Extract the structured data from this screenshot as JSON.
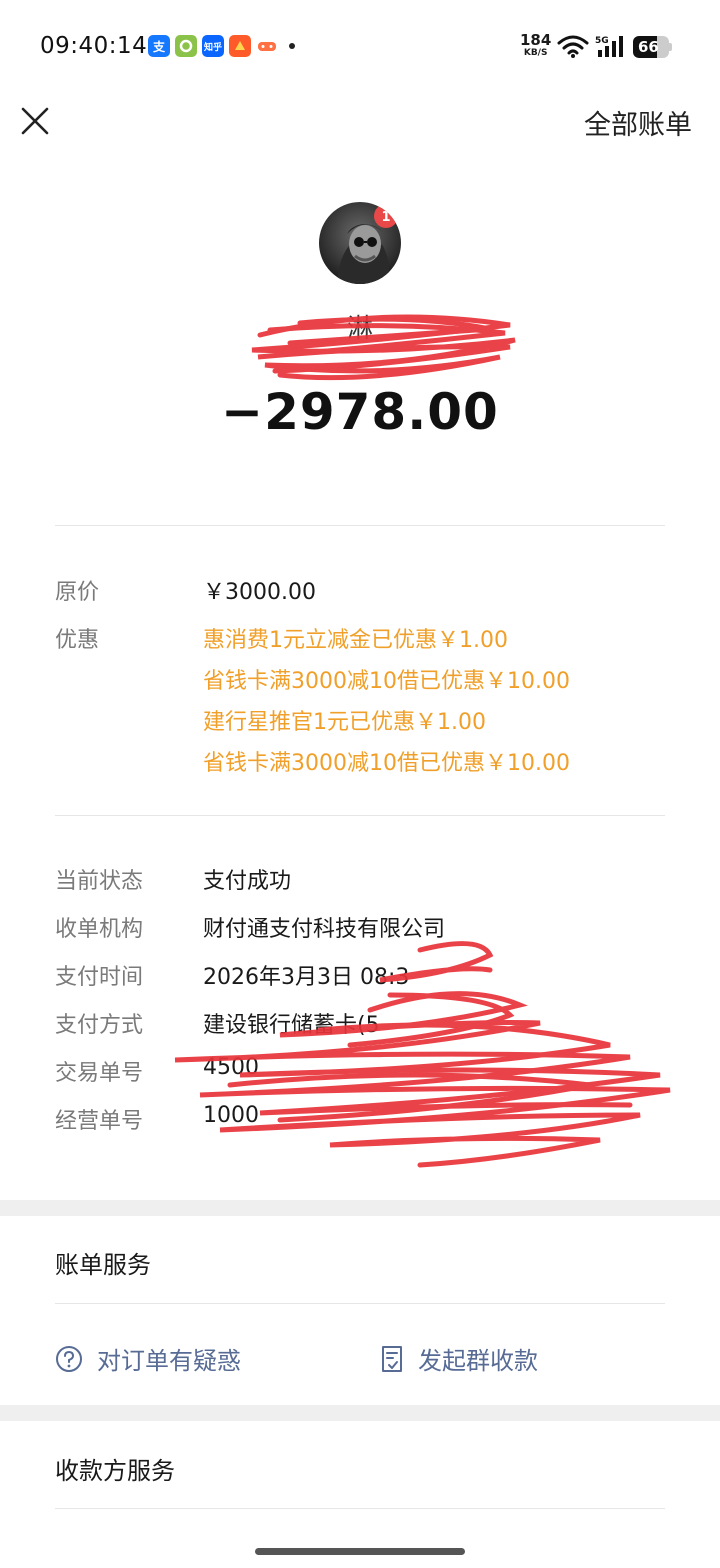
{
  "status_bar": {
    "time": "09:40:14",
    "net_speed_value": "184",
    "net_speed_unit": "KB/S",
    "network": "5G",
    "battery": "66",
    "battery_level": 0.66,
    "app_icons": [
      {
        "name": "alipay-icon",
        "glyph": "支",
        "color": "#1677ff"
      },
      {
        "name": "green-app-icon",
        "glyph": "",
        "color": "#8bc34a"
      },
      {
        "name": "zhihu-icon",
        "glyph": "知乎",
        "color": "#0a66ff"
      },
      {
        "name": "red-app-icon",
        "glyph": "",
        "color": "#ff5a2a"
      },
      {
        "name": "game-icon",
        "glyph": "",
        "color": "#ff7043"
      }
    ]
  },
  "nav": {
    "close_icon": "close-icon",
    "all_bills_label": "全部账单"
  },
  "header": {
    "merchant_name": "淋",
    "amount": "−2978.00",
    "avatar_badge": "1"
  },
  "price": {
    "original_label": "原价",
    "original_value": "￥3000.00",
    "discount_label": "优惠",
    "discounts": [
      "惠消费1元立减金已优惠￥1.00",
      "省钱卡满3000减10借已优惠￥10.00",
      "建行星推官1元已优惠￥1.00",
      "省钱卡满3000减10借已优惠￥10.00"
    ]
  },
  "details": [
    {
      "label": "当前状态",
      "value": "支付成功"
    },
    {
      "label": "收单机构",
      "value": "财付通支付科技有限公司"
    },
    {
      "label": "支付时间",
      "value": "2026年3月3日 08:3"
    },
    {
      "label": "支付方式",
      "value": "建设银行储蓄卡(5"
    },
    {
      "label": "交易单号",
      "value": "4500"
    },
    {
      "label": "经营单号",
      "value": "1000"
    }
  ],
  "bill_service": {
    "title": "账单服务",
    "doubt_label": "对订单有疑惑",
    "group_collect_label": "发起群收款",
    "link_color": "#576b95"
  },
  "payee_service": {
    "title": "收款方服务"
  },
  "colors": {
    "discount": "#f0a02a",
    "scribble": "#e8343a"
  }
}
